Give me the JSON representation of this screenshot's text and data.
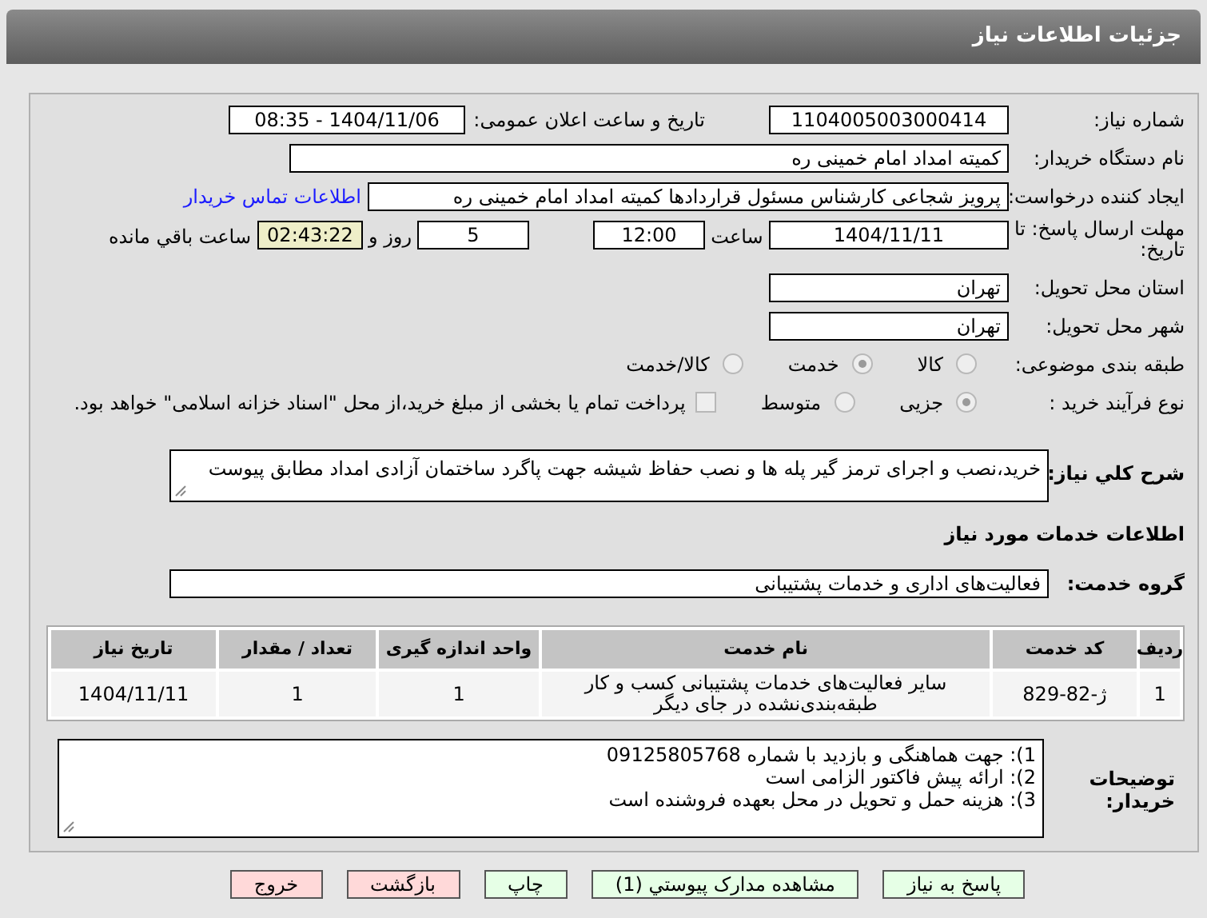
{
  "header": {
    "title": "جزئیات اطلاعات نیاز"
  },
  "need_number": {
    "label": "شماره نیاز:",
    "value": "1104005003000414"
  },
  "announce_datetime": {
    "label": "تاریخ و ساعت اعلان عمومی:",
    "value": "1404/11/06 - 08:35"
  },
  "buyer_org": {
    "label": "نام دستگاه خریدار:",
    "value": "کمیته امداد امام خمینی ره"
  },
  "requester": {
    "label": "ایجاد کننده درخواست:",
    "value": "پرویز شجاعی کارشناس مسئول قراردادها کمیته امداد امام خمینی ره",
    "link": "اطلاعات تماس خریدار"
  },
  "deadline": {
    "label": "مهلت ارسال پاسخ: تا تاریخ:",
    "date": "1404/11/11",
    "time_label": "ساعت",
    "time": "12:00",
    "days": "5",
    "days_label": "روز و",
    "remaining": "02:43:22",
    "remaining_label": "ساعت باقي مانده"
  },
  "province": {
    "label": "استان محل تحویل:",
    "value": "تهران"
  },
  "city": {
    "label": "شهر محل تحویل:",
    "value": "تهران"
  },
  "category": {
    "label": "طبقه بندی موضوعی:",
    "options": [
      {
        "label": "کالا",
        "selected": false
      },
      {
        "label": "خدمت",
        "selected": true
      },
      {
        "label": "کالا/خدمت",
        "selected": false
      }
    ]
  },
  "process": {
    "label": "نوع فرآیند خرید :",
    "options": [
      {
        "label": "جزیی",
        "selected": true
      },
      {
        "label": "متوسط",
        "selected": false
      }
    ],
    "treasury": {
      "checked": false,
      "text": "پرداخت تمام یا بخشی از مبلغ خرید،از محل \"اسناد خزانه اسلامی\" خواهد بود."
    }
  },
  "description": {
    "label": "شرح کلي نیاز:",
    "value": "خرید،نصب و اجرای ترمز گیر پله ها و نصب حفاظ شیشه جهت پاگرد ساختمان آزادی امداد مطابق پیوست"
  },
  "services_heading": "اطلاعات خدمات مورد نیاز",
  "service_group": {
    "label": "گروه خدمت:",
    "value": "فعالیت‌های اداری و خدمات پشتیبانی"
  },
  "table": {
    "columns": [
      "ردیف",
      "کد خدمت",
      "نام خدمت",
      "واحد اندازه گیری",
      "تعداد / مقدار",
      "تاریخ نیاز"
    ],
    "rows": [
      [
        "1",
        "ژ-82-829",
        "سایر فعالیت‌های خدمات پشتیبانی کسب و کار طبقه‌بندی‌نشده در جای دیگر",
        "1",
        "1",
        "1404/11/11"
      ]
    ]
  },
  "buyer_notes": {
    "label": "توضیحات خریدار:",
    "lines": [
      "1): جهت هماهنگی و بازدید با شماره 09125805768",
      "2): ارائه پیش فاکتور الزامی است",
      "3): هزینه حمل و تحویل در محل بعهده فروشنده است"
    ]
  },
  "buttons": [
    {
      "label": "پاسخ به نیاز",
      "kind": "green"
    },
    {
      "label": "مشاهده مدارک پیوستي (1)",
      "kind": "green"
    },
    {
      "label": "چاپ",
      "kind": "green"
    },
    {
      "label": "بازگشت",
      "kind": "red"
    },
    {
      "label": "خروج",
      "kind": "red"
    }
  ]
}
